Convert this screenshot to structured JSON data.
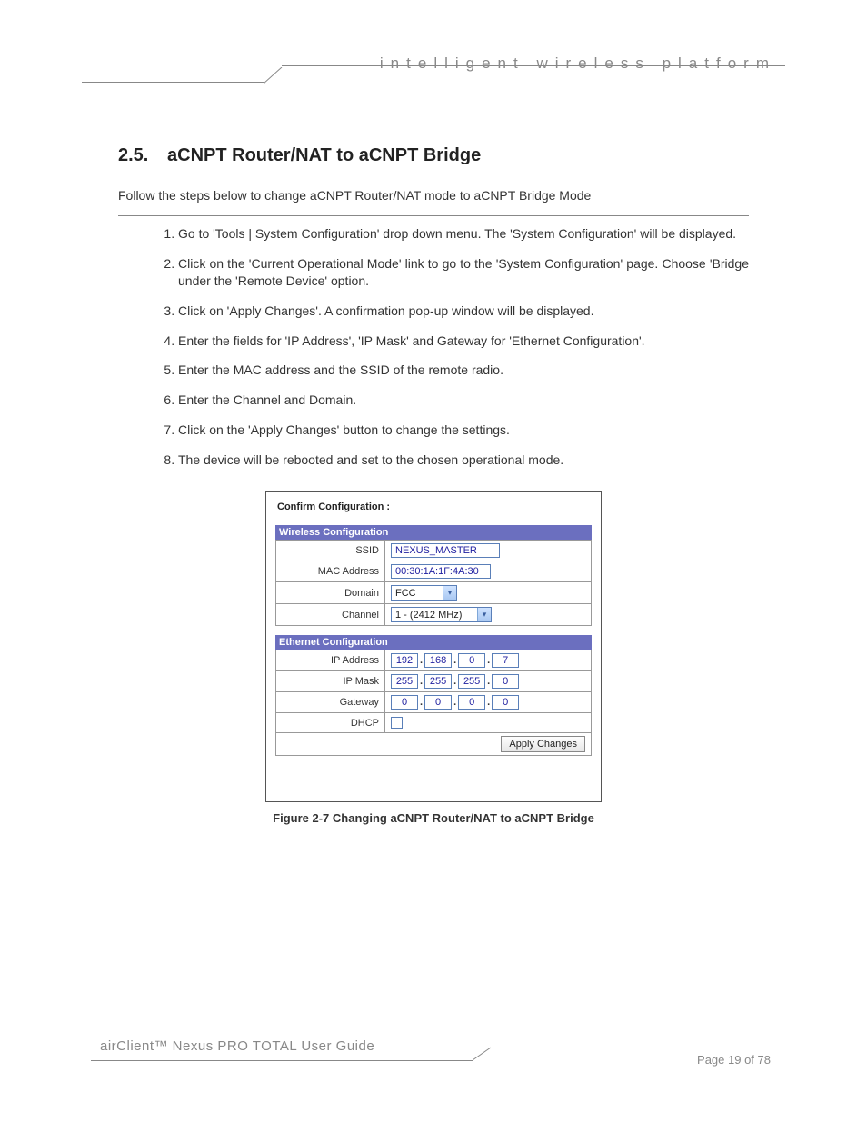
{
  "header": {
    "tagline": "intelligent wireless platform"
  },
  "section": {
    "number": "2.5.",
    "title": "aCNPT Router/NAT to aCNPT Bridge"
  },
  "intro": "Follow the steps below to change aCNPT Router/NAT mode to aCNPT Bridge Mode",
  "steps": [
    "Go to 'Tools | System Configuration' drop down menu. The 'System Configuration' will be displayed.",
    "Click on the 'Current Operational Mode' link to go to the 'System Configuration' page. Choose 'Bridge under the 'Remote Device' option.",
    "Click on 'Apply Changes'. A confirmation pop-up window will be displayed.",
    "Enter the fields for 'IP Address', 'IP Mask' and Gateway for 'Ethernet Configuration'.",
    "Enter the MAC address and the SSID of the remote radio.",
    "Enter the Channel and Domain.",
    "Click on the 'Apply Changes' button to change the settings.",
    "The device will be rebooted and set to the chosen operational mode."
  ],
  "figure": {
    "confirm_title": "Confirm Configuration :",
    "wireless": {
      "header": "Wireless Configuration",
      "ssid_label": "SSID",
      "ssid_value": "NEXUS_MASTER",
      "mac_label": "MAC Address",
      "mac_value": "00:30:1A:1F:4A:30",
      "domain_label": "Domain",
      "domain_value": "FCC",
      "channel_label": "Channel",
      "channel_value": "1 - (2412 MHz)"
    },
    "ethernet": {
      "header": "Ethernet Configuration",
      "ip_label": "IP Address",
      "ip": [
        "192",
        "168",
        "0",
        "7"
      ],
      "mask_label": "IP Mask",
      "mask": [
        "255",
        "255",
        "255",
        "0"
      ],
      "gw_label": "Gateway",
      "gw": [
        "0",
        "0",
        "0",
        "0"
      ],
      "dhcp_label": "DHCP",
      "dhcp_checked": false
    },
    "apply_label": "Apply Changes",
    "caption": "Figure 2-7 Changing aCNPT Router/NAT to aCNPT Bridge"
  },
  "footer": {
    "guide": "airClient™ Nexus PRO TOTAL User Guide",
    "page": "Page 19 of 78"
  }
}
